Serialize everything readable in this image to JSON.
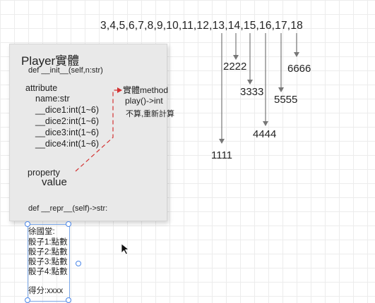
{
  "sequence": "3,4,5,6,7,8,9,10,11,12,13,14,15,16,17,18",
  "class_card": {
    "title": "Player實體",
    "init_sig": "def __init__(self,n:str)",
    "attribute_label": "attribute",
    "attributes": [
      "name:str",
      "__dice1:int(1~6)",
      "__dice2:int(1~6)",
      "__dice3:int(1~6)",
      "__dice4:int(1~6)"
    ],
    "property_label": "property",
    "property_value": "value",
    "repr_sig": "def __repr__(self)->str:"
  },
  "method_note": {
    "heading": "實體method",
    "signature": "play()->int",
    "comment": "不算,重新計算"
  },
  "results": [
    "1111",
    "2222",
    "3333",
    "4444",
    "5555",
    "6666"
  ],
  "text_box": {
    "lines": [
      "徐國堂:",
      "骰子1:點數",
      "骰子2:點數",
      "骰子3:點數",
      "骰子4:點數",
      "",
      "得分:xxxx"
    ]
  },
  "colors": {
    "dashed_arrow": "#d33232",
    "arrows": "#777777",
    "selection": "#4a86e8"
  },
  "cursor_icon": "mouse-pointer-icon"
}
